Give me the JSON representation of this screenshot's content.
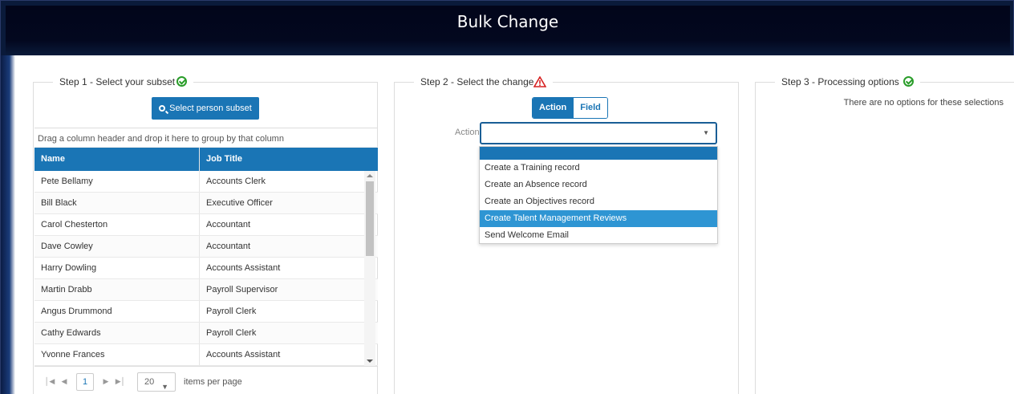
{
  "window": {
    "title": "Bulk Change"
  },
  "step1": {
    "legend": "Step 1 - Select your subset",
    "status_icon": "check-circle-icon",
    "select_button": "Select person subset",
    "group_hint": "Drag a column header and drop it here to group by that column",
    "columns": [
      "Name",
      "Job Title"
    ],
    "rows": [
      [
        "Pete Bellamy",
        "Accounts Clerk"
      ],
      [
        "Bill Black",
        "Executive Officer"
      ],
      [
        "Carol Chesterton",
        "Accountant"
      ],
      [
        "Dave Cowley",
        "Accountant"
      ],
      [
        "Harry Dowling",
        "Accounts Assistant"
      ],
      [
        "Martin Drabb",
        "Payroll Supervisor"
      ],
      [
        "Angus Drummond",
        "Payroll Clerk"
      ],
      [
        "Cathy Edwards",
        "Payroll Clerk"
      ],
      [
        "Yvonne Frances",
        "Accounts Assistant"
      ]
    ],
    "pager": {
      "current_page": "1",
      "page_size": "20",
      "items_per_page_label": "items per page"
    }
  },
  "step2": {
    "legend": "Step 2 - Select the change",
    "status_icon": "warning-icon",
    "toggle": {
      "action": "Action",
      "field": "Field"
    },
    "action_label": "Action",
    "action_value": "",
    "options": [
      "",
      "Create a Training record",
      "Create an Absence record",
      "Create an Objectives record",
      "Create Talent Management Reviews",
      "Send Welcome Email"
    ],
    "highlighted_option": "Create Talent Management Reviews"
  },
  "step3": {
    "legend": "Step 3 - Processing options",
    "status_icon": "check-circle-icon",
    "message": "There are no options for these selections"
  },
  "colors": {
    "primary": "#1a75b5",
    "highlight": "#2e95d3",
    "ok": "#2a9d2a",
    "warn": "#d62020"
  }
}
